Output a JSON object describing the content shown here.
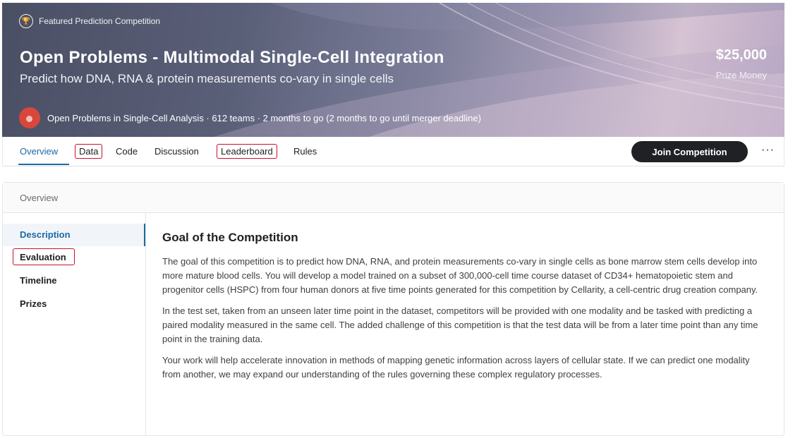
{
  "header": {
    "badge": "Featured Prediction Competition",
    "title": "Open Problems - Multimodal Single-Cell Integration",
    "subtitle": "Predict how DNA, RNA & protein measurements co-vary in single cells",
    "prize_amount": "$25,000",
    "prize_label": "Prize Money",
    "host_info": "Open Problems in Single-Cell Analysis · 612 teams · 2 months to go (2 months to go until merger deadline)"
  },
  "tabs": [
    {
      "label": "Overview"
    },
    {
      "label": "Data"
    },
    {
      "label": "Code"
    },
    {
      "label": "Discussion"
    },
    {
      "label": "Leaderboard"
    },
    {
      "label": "Rules"
    }
  ],
  "actions": {
    "join_label": "Join Competition",
    "more_label": "···"
  },
  "card": {
    "heading": "Overview",
    "sidebar": [
      {
        "label": "Description"
      },
      {
        "label": "Evaluation"
      },
      {
        "label": "Timeline"
      },
      {
        "label": "Prizes"
      }
    ],
    "section_title": "Goal of the Competition",
    "paragraphs": [
      "The goal of this competition is to predict how DNA, RNA, and protein measurements co-vary in single cells as bone marrow stem cells develop into more mature blood cells. You will develop a model trained on a subset of 300,000-cell time course dataset of CD34+ hematopoietic stem and progenitor cells (HSPC) from four human donors at five time points generated for this competition by Cellarity, a cell-centric drug creation company.",
      "In the test set, taken from an unseen later time point in the dataset, competitors will be provided with one modality and be tasked with predicting a paired modality measured in the same cell. The added challenge of this competition is that the test data will be from a later time point than any time point in the training data.",
      "Your work will help accelerate innovation in methods of mapping genetic information across layers of cellular state. If we can predict one modality from another, we may expand our understanding of the rules governing these complex regulatory processes."
    ]
  },
  "colors": {
    "accent": "#1b6aa5",
    "highlight_box": "#c8102e",
    "button": "#202124"
  }
}
